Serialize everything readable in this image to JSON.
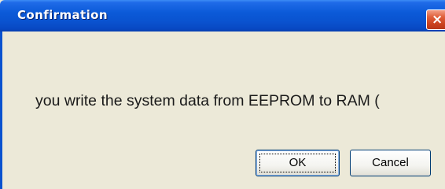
{
  "window": {
    "title": "Confirmation",
    "close_glyph": "×",
    "close_icon": "close-icon"
  },
  "dialog": {
    "message": "you write the system data from EEPROM to RAM (",
    "ok_label": "OK",
    "cancel_label": "Cancel"
  },
  "colors": {
    "titlebar": "#0a52cf",
    "close_button": "#e0603c",
    "dialog_background": "#ece9d8"
  }
}
